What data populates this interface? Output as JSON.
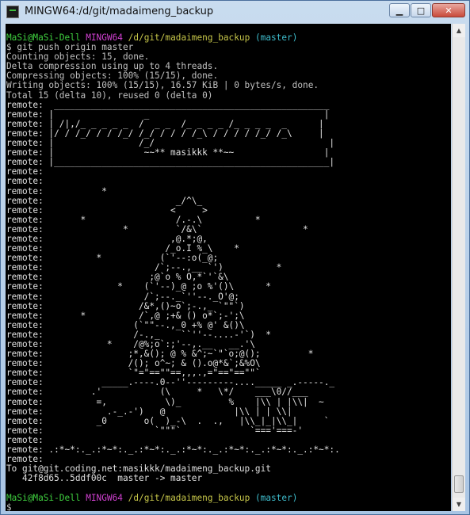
{
  "window": {
    "title": "MINGW64:/d/git/madaimeng_backup",
    "minimize_label": "▁",
    "maximize_label": "□",
    "close_label": "✕"
  },
  "terminal": {
    "prompt_user_1": "MaSi@MaSi-Dell",
    "prompt_env_1": "MINGW64",
    "prompt_path_1": "/d/git/madaimeng_backup",
    "prompt_branch_1": "(master)",
    "command": "$ git push origin master",
    "output_before": "Counting objects: 15, done.\nDelta compression using up to 4 threads.\nCompressing objects: 100% (15/15), done.\nWriting objects: 100% (15/15), 16.57 KiB | 0 bytes/s, done.\nTotal 15 (delta 10), reused 0 (delta 0)",
    "remote_block": "remote:  ____________________________________________________ \nremote: |                 _                                 |\nremote: | /|,/_ _ _ _ _  /  _ _  /_ _ _ _ /_ _ _ _  _      |\nremote: |/ / /_/ / / /_/ /_/ / / / /_\\ / / / / /_/ /_\\     |\nremote: |                /_/                                 |\nremote: |                 ~~** masikkk **~~                 |\nremote: |____________________________________________________|\nremote:\nremote:\nremote:           *\nremote:                         _/^\\_\nremote:                        <     >\nremote:       *                 /.-.\\          *\nremote:               *         `/&\\`                   *\nremote:                        ,@.*;@,\nremote:                       /_o.I %_\\    *\nremote:          *           (`'--:o(_@;\nremote:                     /`;--.,__ `')          *\nremote:                    ;@`o % O,*`'`&\\\nremote:              *    (`'--)_@ ;o %'()\\      *\nremote:                   /`;--._`''--._O'@;\nremote:                  /&*,()~o`;-.,_ `\"\"`)\nremote:       *          /`,@ ;+& () o*`;-';\\\nremote:                 (`\"\"--.,_0 +% @' &()\\\nremote:                 /-.,_    ``''--....-'`)  *\nremote:            *    /@%;o`:;'--,.__   __.'\\\nremote:                ;*,&(); @ % &^;~`\"`o;@();         *\nremote:                /(); o^~; & ().o@*&`;&%O\\\nremote:                `\"=\"==\"\"==,,,.,=\"==\"==\"\"`\nremote:           _____.----.0--''---------...._____ _.-----._\nremote:         .'           (\\     *   \\*/    ___\\0//___\nremote:          =,           \\)_         %    |\\\\ | |\\\\|  ~\nremote:            .-_.-')   @             |\\\\ | | \\\\|\nremote:          _0       o(  )_-\\  .  .,   |\\\\_|_|\\\\_|     `\nremote:                     `\"\"\"`             `==='===-'\nremote:\nremote: .:*~*:._.:*~*:._.:*~*:._.:*~*:._.:*~*:._.:*~*:._.:*~*:.\nremote:\nTo git@git.coding.net:masikkk/madaimeng_backup.git\n   42f8d65..5ddf00c  master -> master",
    "prompt_user_2": "MaSi@MaSi-Dell",
    "prompt_env_2": "MINGW64",
    "prompt_path_2": "/d/git/madaimeng_backup",
    "prompt_branch_2": "(master)",
    "final_prompt": "$"
  },
  "scrollbar": {
    "up_label": "▲",
    "down_label": "▼"
  },
  "colors": {
    "prompt_user": "#3fcf3f",
    "prompt_env": "#cf40cf",
    "prompt_path": "#c8c84a",
    "prompt_branch": "#3fbfcf",
    "terminal_bg": "#000000",
    "terminal_fg": "#c0c0c0"
  }
}
